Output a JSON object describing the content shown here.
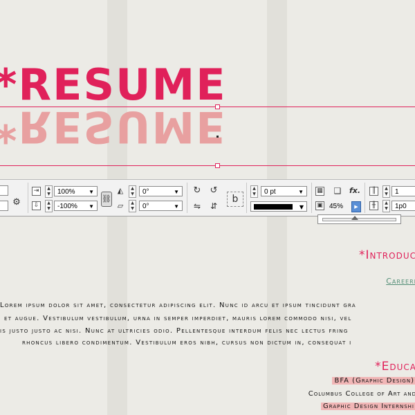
{
  "document": {
    "title": "*RESUME",
    "title_reflection": "*RESUME"
  },
  "control_panel": {
    "scale_x": "100%",
    "scale_y": "-100%",
    "rotate_angle": "0°",
    "shear_angle": "0°",
    "stroke_weight": "0 pt",
    "opacity": "45%",
    "opacity_slider_value": 0.45,
    "columns": "1",
    "gutter": "1p0",
    "icons": {
      "reference_point": "reference-point-icon",
      "constrain": "chain-link-icon",
      "rotate": "rotate-icon",
      "shear": "shear-icon",
      "fx": "fx-icon",
      "shadow": "drop-shadow-icon",
      "text_wrap": "text-wrap-icon"
    }
  },
  "content": {
    "introduction_heading": "*Introduc",
    "career_link": "Careeri",
    "body_lines": [
      "Lorem ipsum dolor sit amet, consectetur adipiscing elit. Nunc id arcu et ipsum tincidunt gra",
      "et augue. Vestibulum vestibulum, urna in semper imperdiet, mauris lorem commodo nisi, vel",
      "is justo justo ac nisi. Nunc at ultricies odio. Pellentesque interdum felis nec lectus fring",
      "rhoncus libero condimentum. Vestibulum eros nibh, cursus non dictum in, consequat i"
    ],
    "education_heading": "*Educa",
    "education_degree": "BFA (Graphic Design)",
    "education_school": "Columbus College of Art and",
    "education_internship": "Graphic Design Internshi"
  },
  "colors": {
    "accent": "#e0215a",
    "reflection": "#e8a0a0",
    "highlight": "#f1b6b6",
    "link": "#4f8c74"
  }
}
